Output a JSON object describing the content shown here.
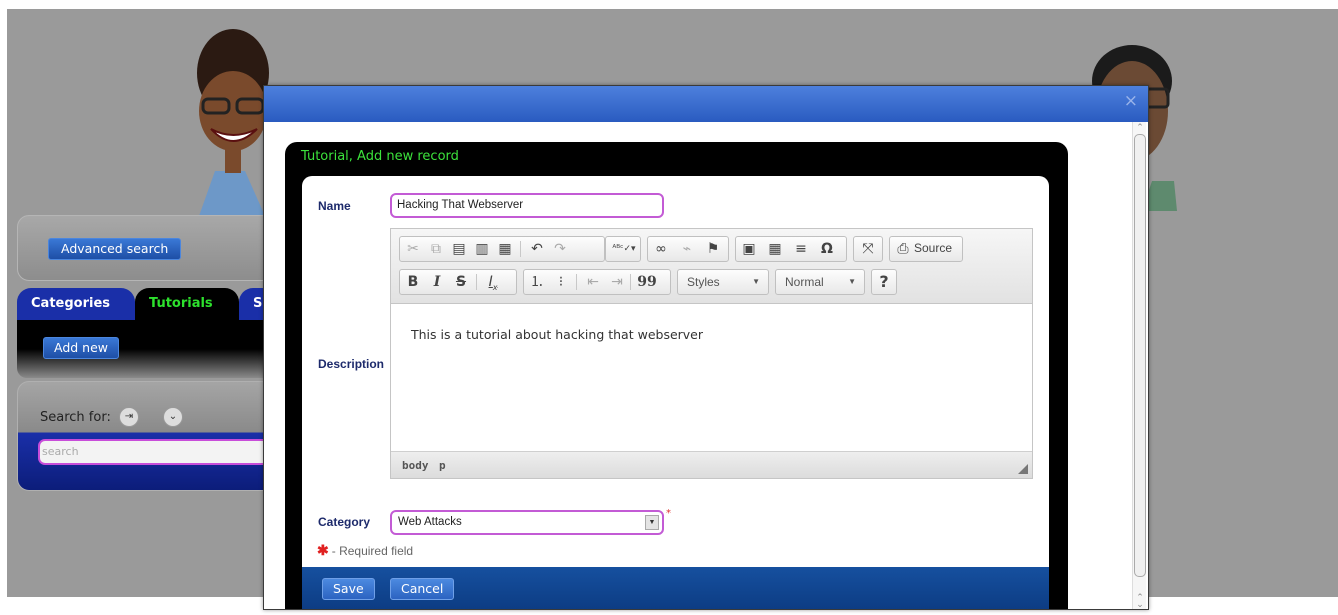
{
  "background": {
    "advanced_search_label": "Advanced search",
    "tabs": [
      {
        "label": "Categories"
      },
      {
        "label": "Tutorials"
      },
      {
        "label": "S"
      }
    ],
    "add_new_label": "Add new",
    "search_for_label": "Search for:",
    "search_placeholder": "search"
  },
  "modal": {
    "close_glyph": "×",
    "form_title": "Tutorial, Add new record",
    "name": {
      "label": "Name",
      "value": "Hacking That Webserver"
    },
    "description": {
      "label": "Description",
      "content": "This is a tutorial about hacking that webserver",
      "toolbar": {
        "source_label": "Source",
        "styles_label": "Styles",
        "format_label": "Normal",
        "bold": "B",
        "italic": "I",
        "strike": "S",
        "blockquote": "99",
        "help": "?"
      },
      "path": [
        "body",
        "p"
      ]
    },
    "category": {
      "label": "Category",
      "selected": "Web Attacks",
      "required_mark": "*"
    },
    "required_note": "- Required field",
    "buttons": {
      "save": "Save",
      "cancel": "Cancel"
    }
  },
  "colors": {
    "titlebar": "#3466cc",
    "form_title": "#3ce23c",
    "focus_border": "#c35bd5",
    "button_bar": "#10468f"
  }
}
